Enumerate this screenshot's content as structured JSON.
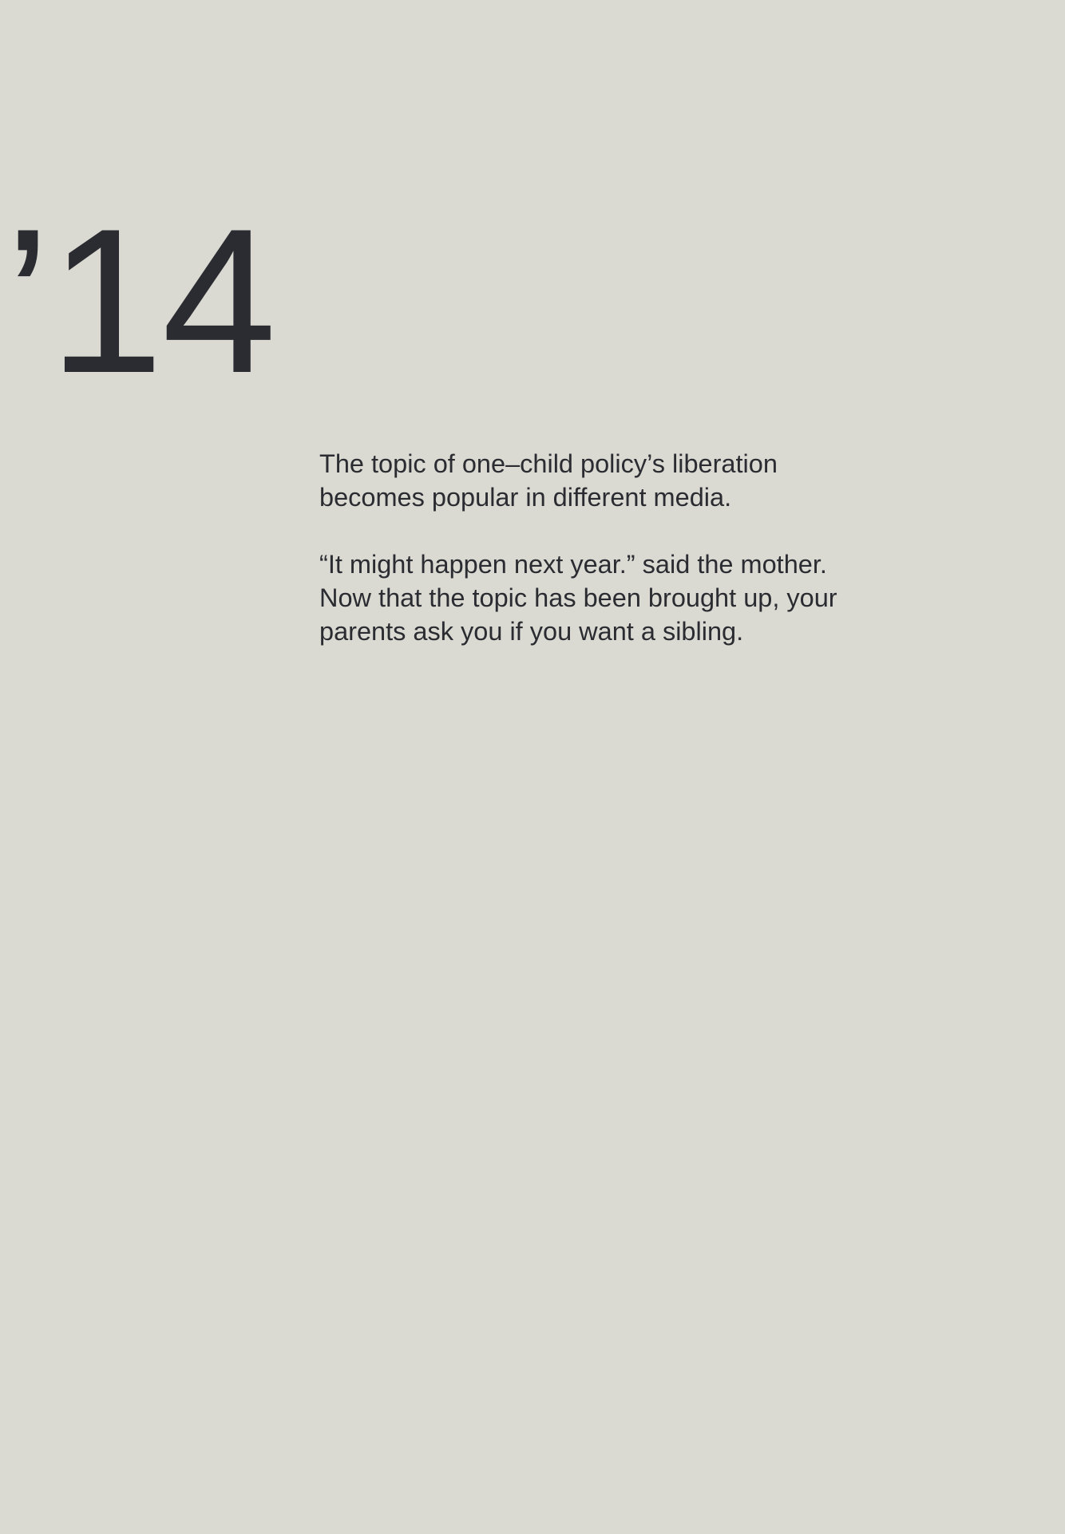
{
  "year": "’14",
  "paragraphs": [
    {
      "lines": [
        "The topic of one–child policy’s liberation",
        "becomes popular in different media."
      ]
    },
    {
      "lines": [
        "“It might happen next year.” said the mother.",
        "Now that the topic has been brought up, your",
        "parents ask you if you want a sibling."
      ]
    }
  ],
  "colors": {
    "background": "#dadad3",
    "text": "#2a2c31"
  }
}
